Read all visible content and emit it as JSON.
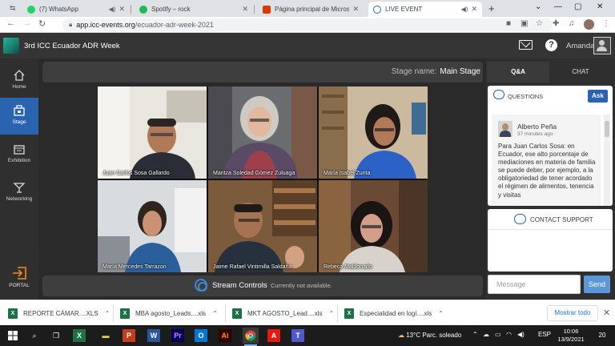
{
  "browser": {
    "tabs": [
      {
        "title": "(7) WhatsApp",
        "color": "#25d366",
        "audio": true
      },
      {
        "title": "Spotify – rock",
        "color": "#1db954",
        "audio": false
      },
      {
        "title": "Página principal de Microsoft Of",
        "color": "#d83b01",
        "audio": false
      },
      {
        "title": "LIVE EVENT",
        "color": "#2a63b0",
        "audio": true,
        "active": true
      }
    ],
    "new_tab": "+",
    "url_domain": "app.icc-events.org",
    "url_path": "/ecuador-adr-week-2021"
  },
  "app": {
    "event_name": "3rd ICC Ecuador ADR Week",
    "username": "Amanda",
    "help": "?"
  },
  "sidebar": {
    "items": [
      {
        "label": "Home",
        "icon": "home-icon"
      },
      {
        "label": "Stage",
        "icon": "stage-icon",
        "active": true
      },
      {
        "label": "Exhibition",
        "icon": "exhibition-icon"
      },
      {
        "label": "Networking",
        "icon": "networking-icon"
      }
    ],
    "portal_label": "PORTAL"
  },
  "stage": {
    "name_label": "Stage name:",
    "name_value": "Main Stage",
    "participants": [
      {
        "name": "Juan Carlos Sosa Gallardo"
      },
      {
        "name": "Maritza Soledad Gómez Zuluaga"
      },
      {
        "name": "María Isabel Zurita"
      },
      {
        "name": "María Mercedes Tarrazon"
      },
      {
        "name": "Jaime Rafael Vintimilla Saldaña"
      },
      {
        "name": "Rebeca Maldonado"
      }
    ],
    "stream_controls_label": "Stream Controls",
    "stream_status": "Currently not available."
  },
  "panel": {
    "tabs": [
      {
        "label": "Q&A",
        "active": true
      },
      {
        "label": "CHAT"
      }
    ],
    "questions_title": "QUESTIONS",
    "ask_label": "Ask",
    "question": {
      "author": "Alberto Peña",
      "time": "37 minutes ago",
      "text": "Para Juan Carlos Sosa: en Ecuador, ese alto porcentaje de mediaciones en materia de familia se puede deber, por ejemplo, a la obligatoriedad de tener acordado el régimen de alimentos, tenencia y visitas"
    },
    "support_label": "CONTACT SUPPORT",
    "message_placeholder": "Message",
    "send_label": "Send"
  },
  "downloads": {
    "items": [
      {
        "name": "REPORTE CÁMAR....XLS"
      },
      {
        "name": "MBA agosto_Leads....xls"
      },
      {
        "name": "MKT AGOSTO_Lead....xls"
      },
      {
        "name": "Especialidad en logí....xls"
      }
    ],
    "show_all": "Mostrar todo"
  },
  "taskbar": {
    "weather_temp": "13°C",
    "weather_text": "Parc. soleado",
    "lang": "ESP",
    "time": "10:06",
    "date": "13/9/2021",
    "notifications": "20"
  }
}
